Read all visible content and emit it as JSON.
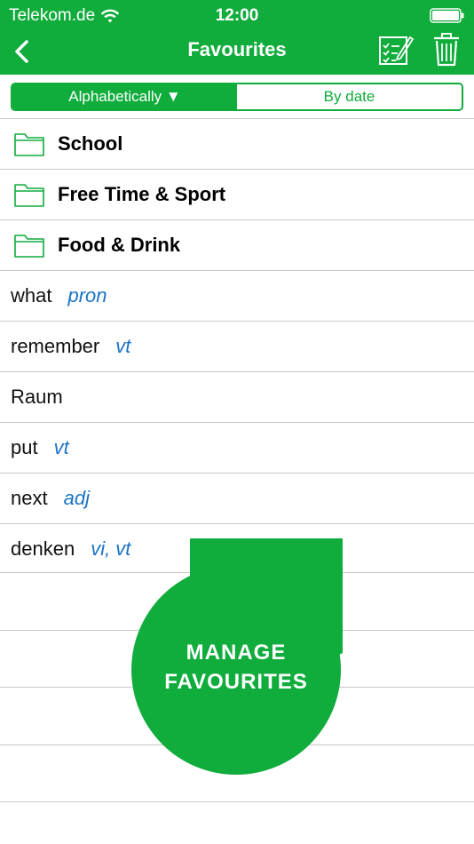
{
  "status": {
    "carrier": "Telekom.de",
    "time": "12:00"
  },
  "navbar": {
    "title": "Favourites"
  },
  "sort": {
    "alphabetical_label": "Alphabetically ▼",
    "by_date_label": "By date",
    "selected": "Alphabetically"
  },
  "folders": [
    {
      "label": "School"
    },
    {
      "label": "Free Time & Sport"
    },
    {
      "label": "Food & Drink"
    }
  ],
  "words": [
    {
      "word": "what",
      "pos": "pron"
    },
    {
      "word": "remember",
      "pos": "vt"
    },
    {
      "word": "Raum",
      "pos": ""
    },
    {
      "word": "put",
      "pos": "vt"
    },
    {
      "word": "next",
      "pos": "adj"
    },
    {
      "word": "denken",
      "pos": "vi, vt"
    }
  ],
  "fab": {
    "line1": "MANAGE",
    "line2": "FAVOURITES"
  },
  "colors": {
    "brand_green": "#10ac3c",
    "pos_blue": "#1a73c7",
    "divider": "#c8c8c8"
  },
  "icons": {
    "back": "chevron-left-icon",
    "edit": "checklist-edit-icon",
    "trash": "trash-icon",
    "folder": "folder-icon"
  }
}
